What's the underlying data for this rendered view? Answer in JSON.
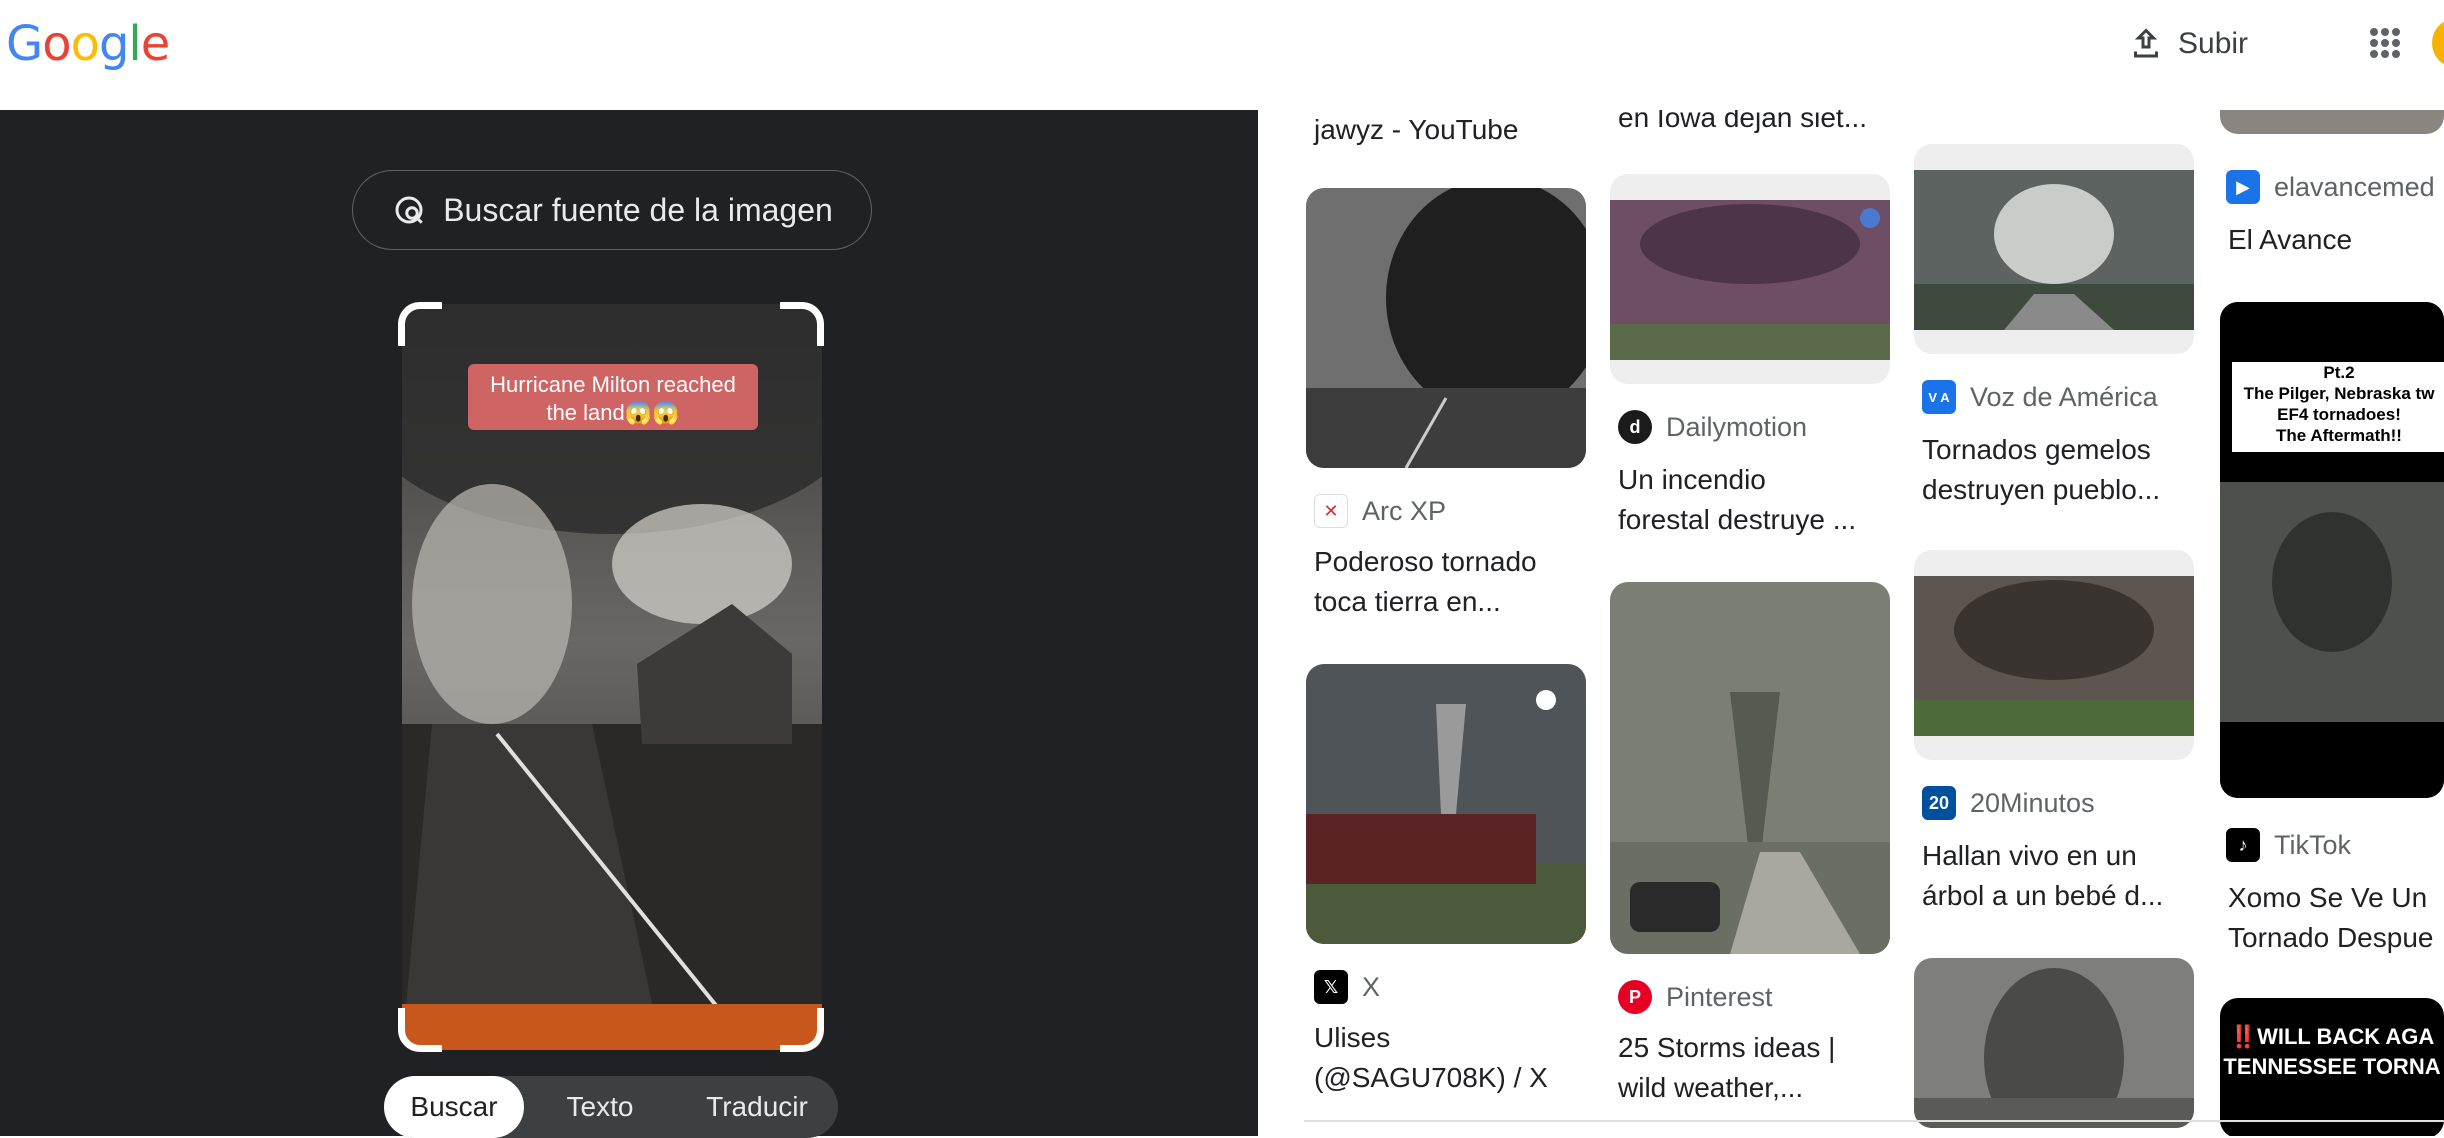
{
  "header": {
    "logo": [
      {
        "ch": "G",
        "color": "#4285F4"
      },
      {
        "ch": "o",
        "color": "#EA4335"
      },
      {
        "ch": "o",
        "color": "#FBBC05"
      },
      {
        "ch": "g",
        "color": "#4285F4"
      },
      {
        "ch": "l",
        "color": "#34A853"
      },
      {
        "ch": "e",
        "color": "#EA4335"
      }
    ],
    "upload_label": "Subir"
  },
  "left": {
    "source_button": "Buscar fuente de la imagen",
    "overlay_line1": "Hurricane Milton reached",
    "overlay_line2": "the land😱😱",
    "tabs": [
      "Buscar",
      "Texto",
      "Traducir"
    ],
    "active_tab": "Buscar"
  },
  "results": {
    "top_title_col1": "jawyz - YouTube",
    "top_title_col2": "en Iowa dejan siet...",
    "col1": [
      {
        "source": "Arc XP",
        "title": "Poderoso tornado\ntoca tierra en..."
      },
      {
        "source": "X",
        "title": "Ulises\n(@SAGU708K) / X"
      }
    ],
    "col2": [
      {
        "source": "Dailymotion",
        "title": "Un incendio\nforestal destruye ..."
      },
      {
        "source": "Pinterest",
        "title": "25 Storms ideas |\nwild weather,..."
      }
    ],
    "col3": [
      {
        "source": "Voz de América",
        "title": "Tornados gemelos\ndestruyen pueblo..."
      },
      {
        "source": "20Minutos",
        "title": "Hallan vivo en un\nárbol a un bebé d..."
      }
    ],
    "col4": [
      {
        "source": "elavancemed",
        "title": "El Avance"
      },
      {
        "source": "TikTok",
        "title": "Xomo Se Ve Un\nTornado Despue"
      }
    ],
    "pilger_caption": "Pt.2\nThe Pilger, Nebraska tw\nEF4 tornadoes!\nThe Aftermath!!",
    "tennessee_caption": "‼️WILL BACK AGA\nTENNESSEE TORNA",
    "voa_icon_text": "V A",
    "twenty_icon_text": "20"
  }
}
